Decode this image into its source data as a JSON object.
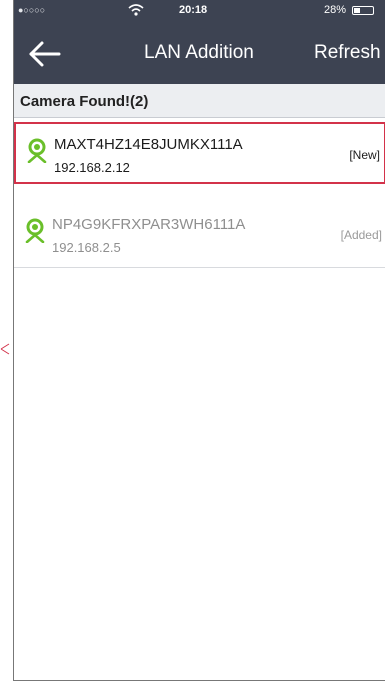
{
  "status_bar": {
    "signal": "●○○○○",
    "time": "20:18",
    "battery_percent": "28%"
  },
  "nav": {
    "title": "LAN Addition",
    "refresh_label": "Refresh",
    "back_icon": "arrow-left-icon"
  },
  "section": {
    "header": "Camera Found!(2)"
  },
  "cameras": [
    {
      "name": "MAXT4HZ14E8JUMKX111A",
      "ip": "192.168.2.12",
      "status": "[New]",
      "icon": "camera-icon"
    },
    {
      "name": "NP4G9KFRXPAR3WH6111A",
      "ip": "192.168.2.5",
      "status": "[Added]",
      "icon": "camera-icon"
    }
  ],
  "colors": {
    "navbar": "#3d4352",
    "accent_green": "#6abf2a",
    "highlight_border": "#d3324a"
  }
}
